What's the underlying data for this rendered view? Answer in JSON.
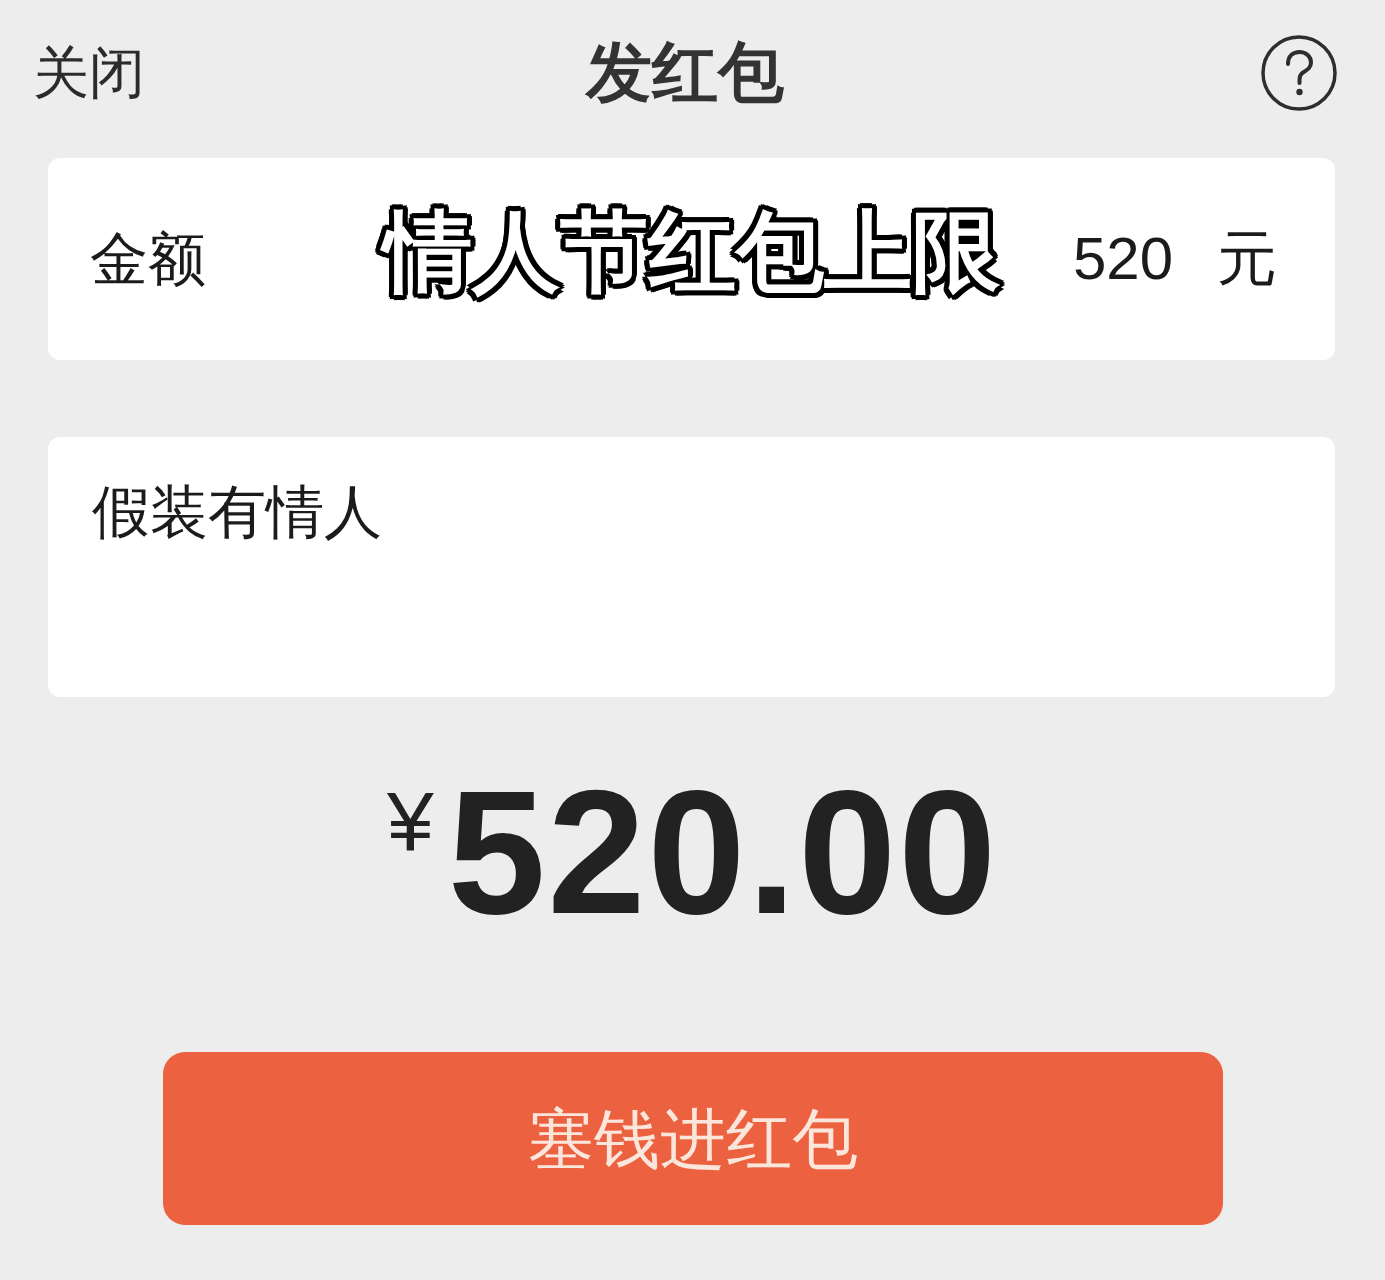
{
  "header": {
    "close": "关闭",
    "title": "发红包"
  },
  "amount_row": {
    "label": "金额",
    "value": "520",
    "unit": "元"
  },
  "caption": "情人节红包上限",
  "message": {
    "value": "假装有情人"
  },
  "total": {
    "currency": "¥",
    "amount": "520.00"
  },
  "submit_button": "塞钱进红包"
}
